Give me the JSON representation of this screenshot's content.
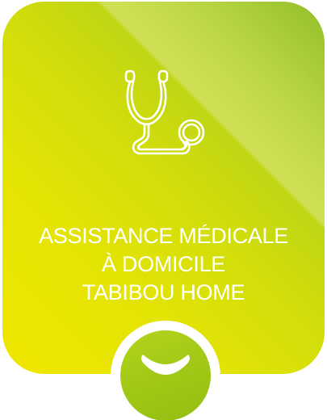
{
  "card": {
    "title_lines": [
      "ASSISTANCE MÉDICALE",
      "À DOMICILE",
      "TABIBOU HOME"
    ],
    "icon": "stethoscope-icon"
  },
  "expand": {
    "icon": "chevron-down-icon"
  },
  "colors": {
    "card_top": "#8fbe2a",
    "card_bottom": "#f0e600",
    "button": "#a3c917",
    "text": "#ffffff"
  }
}
